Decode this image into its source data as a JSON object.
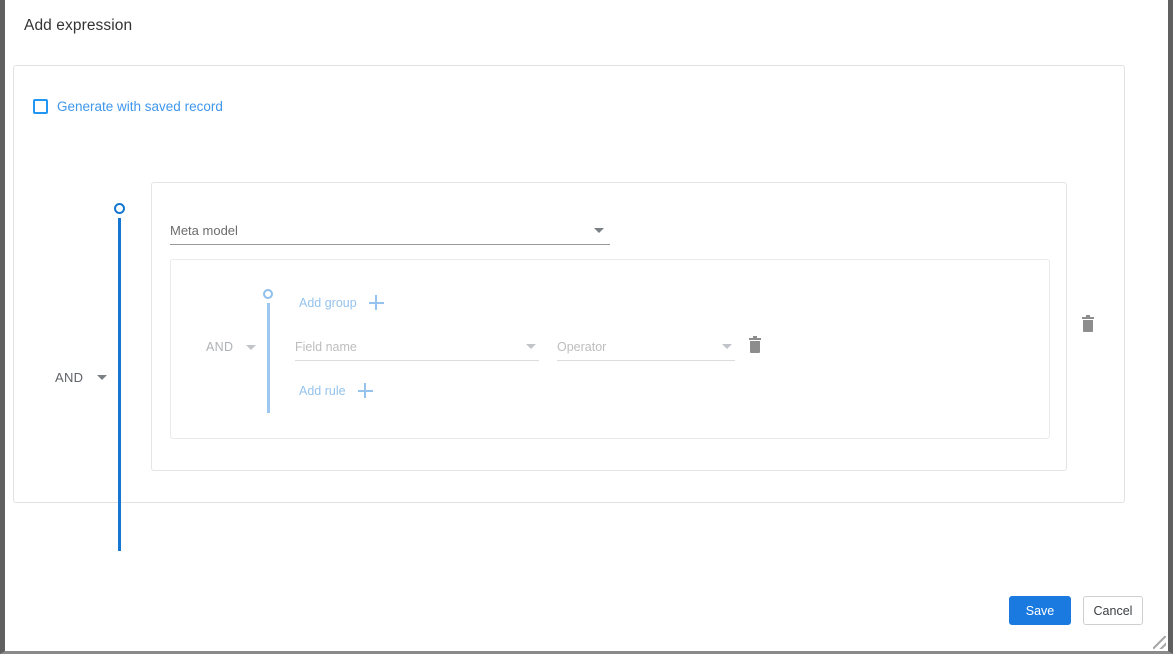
{
  "window": {
    "title": "Add expression"
  },
  "form": {
    "generate_checkbox": {
      "label": "Generate with saved record",
      "checked": false
    },
    "expression_rail": {
      "add_expression_label": "Add expression",
      "join_operator": "AND"
    },
    "expression": {
      "meta_model": {
        "value": "Meta model",
        "placeholder": "Meta model"
      },
      "group": {
        "add_group_label": "Add group",
        "add_rule_label": "Add rule",
        "join_operator": "AND",
        "rule": {
          "field_name": {
            "value": "Field name",
            "placeholder": "Field name"
          },
          "operator": {
            "value": "Operator",
            "placeholder": "Operator"
          }
        }
      }
    }
  },
  "footer": {
    "save_label": "Save",
    "cancel_label": "Cancel"
  },
  "icons": {
    "checkbox": "checkbox-unchecked-icon",
    "plus": "plus-icon",
    "caret": "chevron-down-icon",
    "trash": "trash-icon",
    "node": "rail-node-icon",
    "resize": "resize-grip-icon"
  },
  "colors": {
    "accent": "#1a7ae0",
    "link_strong": "#2f7fd6",
    "link_soft": "#95c3ee",
    "rail_strong": "#1577d2",
    "rail_soft": "#9cc7ef",
    "checkbox_border": "#2196f3",
    "checkbox_label": "#3f97ec",
    "text_dark": "#333333",
    "text_muted": "#6c6c6c",
    "text_placeholder": "#bdbdbd"
  }
}
